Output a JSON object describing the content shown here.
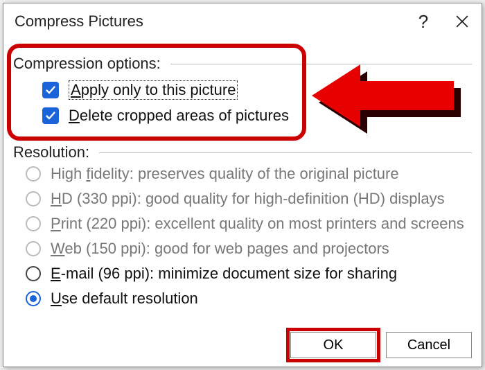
{
  "titlebar": {
    "title": "Compress Pictures",
    "help_label": "?",
    "close_label": "Close"
  },
  "compression": {
    "section_title": "Compression options:",
    "apply_only": {
      "prefix": "A",
      "rest": "pply only to this picture",
      "checked": true
    },
    "delete_cropped": {
      "prefix": "D",
      "rest": "elete cropped areas of pictures",
      "checked": true
    }
  },
  "resolution": {
    "section_title": "Resolution:",
    "options": [
      {
        "prefix": "f",
        "pre": "High ",
        "rest": "idelity: preserves quality of the original picture",
        "enabled": false,
        "selected": false
      },
      {
        "prefix": "H",
        "pre": "",
        "rest": "D (330 ppi): good quality for high-definition (HD) displays",
        "enabled": false,
        "selected": false
      },
      {
        "prefix": "P",
        "pre": "",
        "rest": "rint (220 ppi): excellent quality on most printers and screens",
        "enabled": false,
        "selected": false
      },
      {
        "prefix": "W",
        "pre": "",
        "rest": "eb (150 ppi): good for web pages and projectors",
        "enabled": false,
        "selected": false
      },
      {
        "prefix": "E",
        "pre": "",
        "rest": "-mail (96 ppi): minimize document size for sharing",
        "enabled": true,
        "selected": false
      },
      {
        "prefix": "U",
        "pre": "",
        "rest": "se default resolution",
        "enabled": true,
        "selected": true
      }
    ]
  },
  "buttons": {
    "ok": "OK",
    "cancel": "Cancel"
  },
  "annotations": {
    "highlight_box": "compression-options-highlight",
    "arrow": "arrow-annotation",
    "ok_highlight": "ok-button-highlight"
  }
}
